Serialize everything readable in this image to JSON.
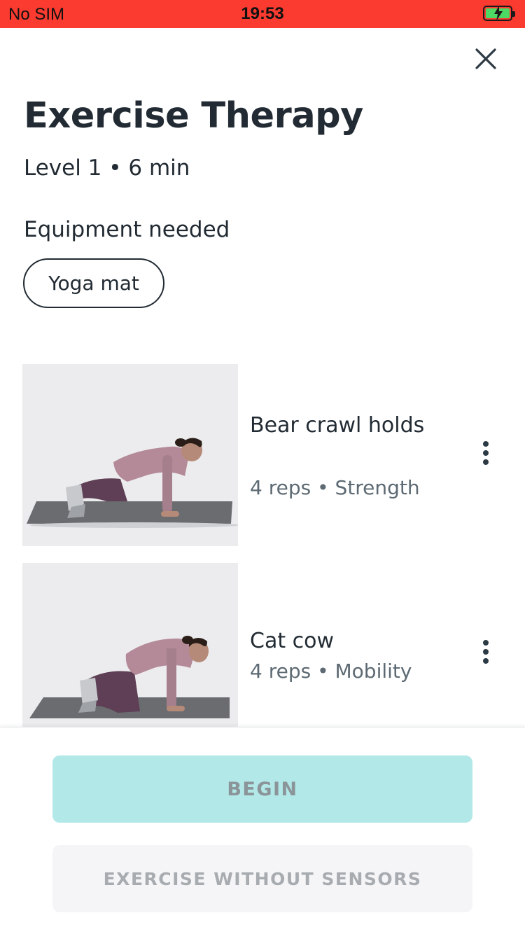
{
  "status_bar": {
    "carrier": "No SIM",
    "time": "19:53",
    "battery_icon": "battery-charging-icon"
  },
  "header": {
    "close_icon": "close-icon",
    "title": "Exercise Therapy",
    "subtitle": "Level 1 • 6 min"
  },
  "equipment": {
    "heading": "Equipment needed",
    "items": [
      "Yoga mat"
    ]
  },
  "exercises": [
    {
      "name": "Bear crawl holds",
      "meta": "4 reps • Strength",
      "image": "woman in bear crawl hold on yoga mat"
    },
    {
      "name": "Cat cow",
      "meta": "4 reps • Mobility",
      "image": "woman on hands and knees on yoga mat"
    }
  ],
  "actions": {
    "begin_label": "BEGIN",
    "no_sensor_label": "EXERCISE WITHOUT SENSORS"
  },
  "colors": {
    "status_bar": "#fb3b30",
    "primary_button": "#b2e9e8",
    "secondary_button": "#f5f5f7",
    "text_dark": "#222b33",
    "text_muted": "#5d6a73"
  }
}
